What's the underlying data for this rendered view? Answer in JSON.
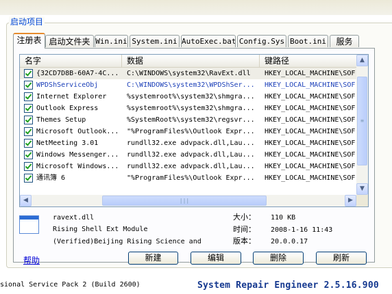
{
  "group": {
    "legend": "启动项目"
  },
  "tabs": [
    {
      "label": "注册表",
      "active": true
    },
    {
      "label": "启动文件夹"
    },
    {
      "label": "Win.ini"
    },
    {
      "label": "System.ini"
    },
    {
      "label": "AutoExec.bat"
    },
    {
      "label": "Config.Sys"
    },
    {
      "label": "Boot.ini"
    },
    {
      "label": "服务"
    }
  ],
  "list": {
    "columns": [
      "名字",
      "数据",
      "键路径"
    ],
    "rows": [
      {
        "name": "{32CD7D8B-60A7-4C...",
        "data": "C:\\WINDOWS\\system32\\RavExt.dll",
        "key": "HKEY_LOCAL_MACHINE\\SOF",
        "checked": true,
        "selected": true,
        "highlight": false
      },
      {
        "name": "WPDShServiceObj",
        "data": "C:\\WINDOWS\\system32\\WPDShSer...",
        "key": "HKEY_LOCAL_MACHINE\\SOF",
        "checked": true,
        "selected": false,
        "highlight": true
      },
      {
        "name": "Internet Explorer",
        "data": "%systemroot%\\system32\\shmgra...",
        "key": "HKEY_LOCAL_MACHINE\\SOF",
        "checked": true,
        "selected": false,
        "highlight": false
      },
      {
        "name": "Outlook Express",
        "data": "%systemroot%\\system32\\shmgra...",
        "key": "HKEY_LOCAL_MACHINE\\SOF",
        "checked": true,
        "selected": false,
        "highlight": false
      },
      {
        "name": "Themes Setup",
        "data": "%SystemRoot%\\system32\\regsvr...",
        "key": "HKEY_LOCAL_MACHINE\\SOF",
        "checked": true,
        "selected": false,
        "highlight": false
      },
      {
        "name": "Microsoft Outlook...",
        "data": "\"%ProgramFiles%\\Outlook Expr...",
        "key": "HKEY_LOCAL_MACHINE\\SOF",
        "checked": true,
        "selected": false,
        "highlight": false
      },
      {
        "name": "NetMeeting 3.01",
        "data": "rundll32.exe advpack.dll,Lau...",
        "key": "HKEY_LOCAL_MACHINE\\SOF",
        "checked": true,
        "selected": false,
        "highlight": false
      },
      {
        "name": "Windows Messenger...",
        "data": "rundll32.exe advpack.dll,Lau...",
        "key": "HKEY_LOCAL_MACHINE\\SOF",
        "checked": true,
        "selected": false,
        "highlight": false
      },
      {
        "name": "Microsoft Windows...",
        "data": "rundll32.exe advpack.dll,Lau...",
        "key": "HKEY_LOCAL_MACHINE\\SOF",
        "checked": true,
        "selected": false,
        "highlight": false
      },
      {
        "name": "通讯簿 6",
        "data": "\"%ProgramFiles%\\Outlook Expr...",
        "key": "HKEY_LOCAL_MACHINE\\SOF",
        "checked": true,
        "selected": false,
        "highlight": false
      }
    ]
  },
  "details": {
    "filename": "ravext.dll",
    "description": "Rising Shell Ext Module",
    "company": "(Verified)Beijing Rising Science and",
    "size_label": "大小：",
    "size_value": "110 KB",
    "time_label": "时间：",
    "time_value": "2008-1-16 11:43",
    "version_label": "版本：",
    "version_value": "20.0.0.17"
  },
  "actions": {
    "help": "帮助",
    "new": "新建",
    "edit": "编辑",
    "delete": "删除",
    "refresh": "刷新"
  },
  "status": {
    "left": "sional Service Pack 2 (Build 2600)",
    "right": "System Repair Engineer 2.5.16.900"
  },
  "colors": {
    "accent_blue": "#0046d5",
    "tab_highlight": "#e68b2c",
    "title_blue": "#14388f",
    "link_blue": "#1b3fb8"
  }
}
